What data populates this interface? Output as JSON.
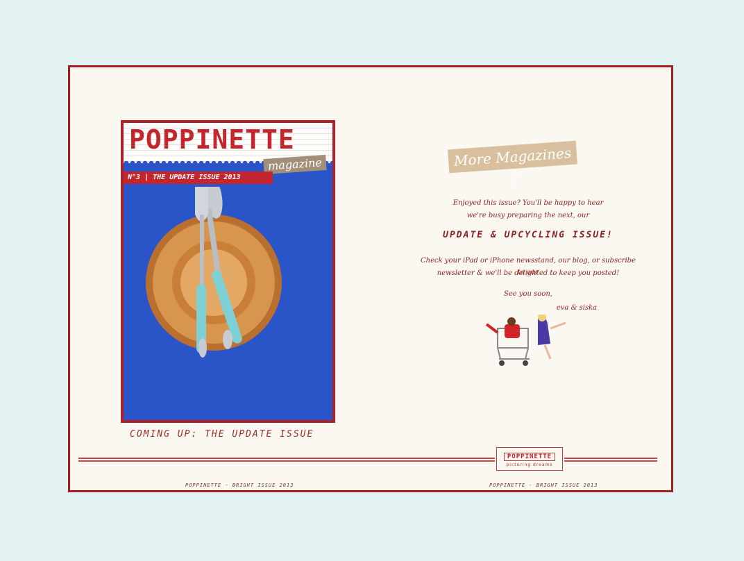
{
  "cover": {
    "title": "POPPINETTE",
    "tag": "magazine",
    "ribbon": "N°3  |   THE UPDATE ISSUE 2013"
  },
  "left_caption": "COMING UP: THE UPDATE ISSUE",
  "right": {
    "banner": "More Magazines ?",
    "intro_line1": "Enjoyed this issue? You'll be happy to hear",
    "intro_line2": "we're busy preparing the next,  our",
    "issue_name": "UPDATE & UPCYCLING ISSUE!",
    "check_line1": "Check your iPad or iPhone newsstand, our blog, or subscribe to our",
    "check_line2": "newsletter & we'll be delighted to keep you posted!",
    "see_you": "See you soon,",
    "signature": "eva & siska"
  },
  "stamp": {
    "name": "POPPINETTE",
    "tagline": "picturing dreams"
  },
  "footer": {
    "left": "POPPINETTE - BRIGHT ISSUE 2013",
    "right": "POPPINETTE - BRIGHT ISSUE 2013"
  },
  "colors": {
    "accent_red": "#a51f1f",
    "background": "#e3f2f2",
    "paper": "#fbf8f1",
    "cover_blue": "#2a55c9"
  }
}
